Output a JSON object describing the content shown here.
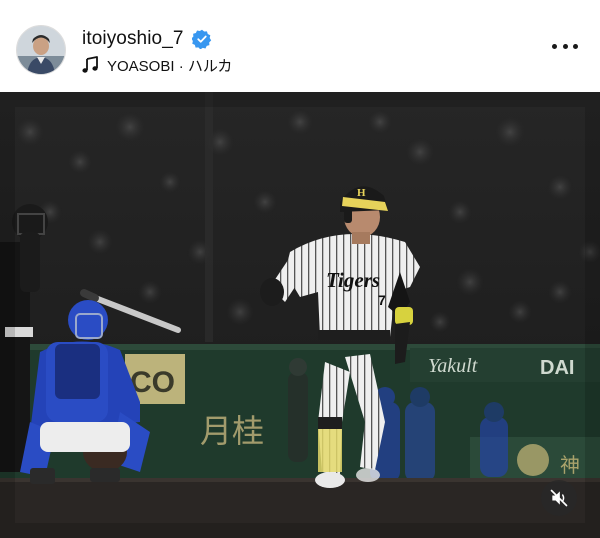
{
  "post": {
    "header": {
      "username": "itoiyoshio_7",
      "verified": true,
      "avatar_icon": "profile-photo",
      "audio": {
        "icon": "music-note-icon",
        "track": "YOASOBI · ハルカ"
      },
      "more_icon": "more-options-icon"
    },
    "media": {
      "type": "photo",
      "jersey_text": "Tigers",
      "jersey_number": "7",
      "helmet_logo": "H",
      "wall_banner_left": "CO",
      "wall_banner_center": "月桂",
      "wall_banner_right": "DAI",
      "wall_script": "Yakult",
      "wall_banner_bottom_right": "神",
      "mute_icon": "muted-speaker-icon"
    },
    "colors": {
      "verified_blue": "#3897f0",
      "text": "#111111",
      "tigers_stripe": "#2a2a2a",
      "dragons_blue": "#2443b8",
      "wall_green": "#1f3a2c"
    }
  }
}
